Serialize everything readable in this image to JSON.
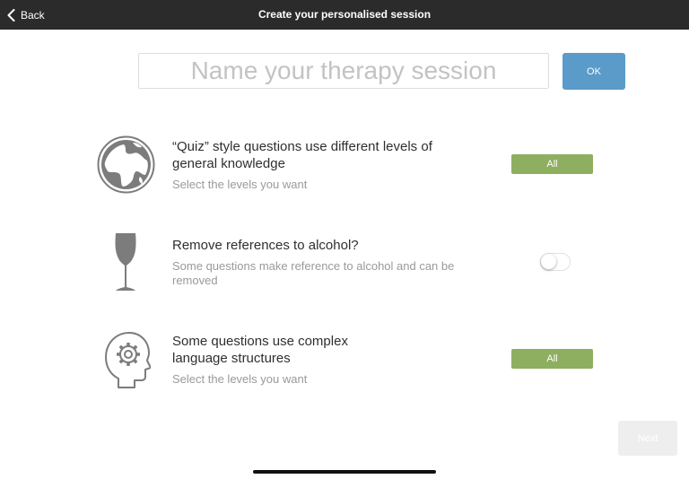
{
  "header": {
    "back_label": "Back",
    "title": "Create your personalised session"
  },
  "session_name": {
    "placeholder": "Name your therapy session",
    "value": "",
    "ok_label": "OK"
  },
  "options": [
    {
      "icon": "globe-icon",
      "title": "“Quiz” style questions use different levels of general knowledge",
      "subtitle": "Select the levels you want",
      "control": "button",
      "control_label": "All"
    },
    {
      "icon": "wine-glass-icon",
      "title": "Remove references to alcohol?",
      "subtitle": "Some questions make reference to alcohol and can be removed",
      "control": "toggle",
      "toggle_on": false
    },
    {
      "icon": "head-gear-icon",
      "title": "Some questions use complex language structures",
      "subtitle": "Select the levels you want",
      "control": "button",
      "control_label": "All"
    }
  ],
  "footer": {
    "next_label": "Next",
    "next_enabled": false
  },
  "colors": {
    "header_bg": "#2b2b2b",
    "ok_button": "#5a9bc9",
    "pill_green": "#8faf60",
    "icon_gray": "#7c7c7c"
  }
}
